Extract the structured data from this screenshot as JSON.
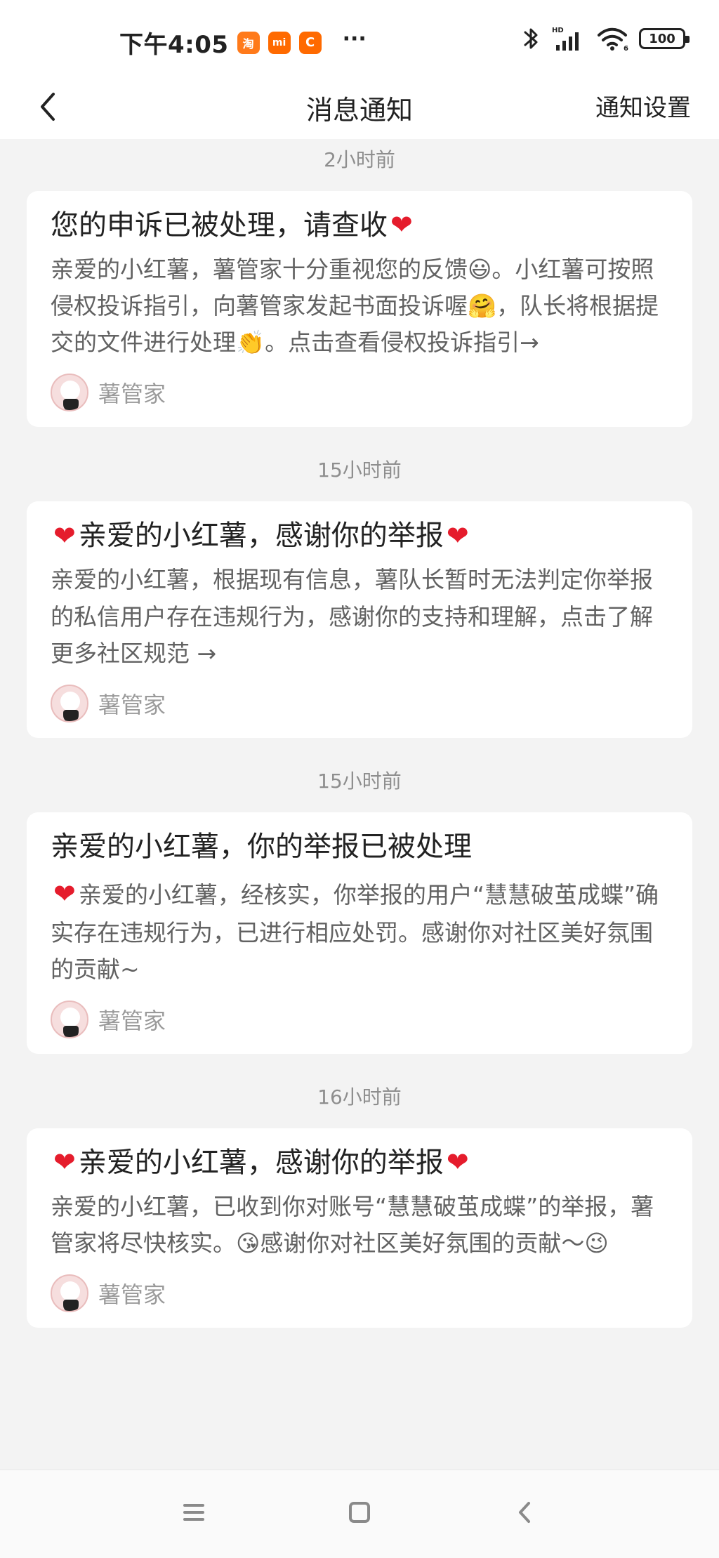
{
  "status_bar": {
    "time": "下午4:05",
    "app_badges": [
      "淘",
      "mi",
      "C"
    ],
    "more": "···",
    "battery": "100"
  },
  "header": {
    "title": "消息通知",
    "settings": "通知设置"
  },
  "notifications": [
    {
      "time": "2小时前",
      "title": "您的申诉已被处理，请查收",
      "body": "亲爱的小红薯，薯管家十分重视您的反馈😃。小红薯可按照侵权投诉指引，向薯管家发起书面投诉喔🤗，队长将根据提交的文件进行处理👏。点击查看侵权投诉指引→",
      "sender": "薯管家"
    },
    {
      "time": "15小时前",
      "title": "亲爱的小红薯，感谢你的举报",
      "body": "亲爱的小红薯，根据现有信息，薯队长暂时无法判定你举报的私信用户存在违规行为，感谢你的支持和理解，点击了解更多社区规范 →",
      "sender": "薯管家"
    },
    {
      "time": "15小时前",
      "title": "亲爱的小红薯，你的举报已被处理",
      "body": "亲爱的小红薯，经核实，你举报的用户“慧慧破茧成蝶”确实存在违规行为，已进行相应处罚。感谢你对社区美好氛围的贡献~",
      "sender": "薯管家"
    },
    {
      "time": "16小时前",
      "title": "亲爱的小红薯，感谢你的举报",
      "body": "亲爱的小红薯，已收到你对账号“慧慧破茧成蝶”的举报，薯管家将尽快核实。😘感谢你对社区美好氛围的贡献～😉",
      "sender": "薯管家"
    }
  ],
  "colors": {
    "heart": "#e51c2c",
    "page_background": "#f3f3f3",
    "card_background": "#ffffff",
    "meta_text": "#8e8e8e"
  },
  "icons": {
    "back": "back-icon",
    "heart": "heart-icon",
    "menu": "menu-icon",
    "home": "home-icon",
    "navigation_back": "navigation-back-icon"
  }
}
